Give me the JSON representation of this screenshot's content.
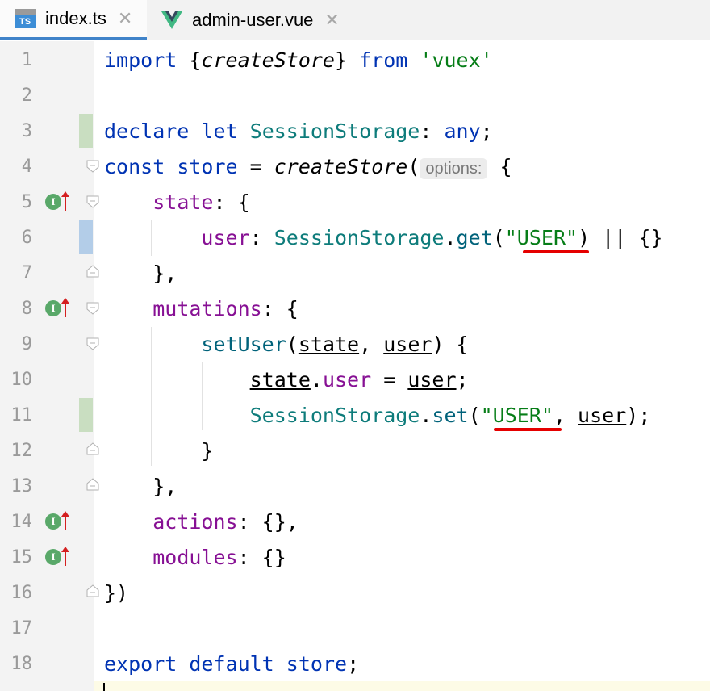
{
  "tabs": [
    {
      "icon": "typescript-file-icon",
      "icon_text": "TS",
      "label": "index.ts",
      "active": true
    },
    {
      "icon": "vue-file-icon",
      "label": "admin-user.vue",
      "active": false
    }
  ],
  "close_glyph": "✕",
  "gutter": {
    "implements_badge": "I",
    "line_numbers": [
      "1",
      "2",
      "3",
      "4",
      "5",
      "6",
      "7",
      "8",
      "9",
      "10",
      "11",
      "12",
      "13",
      "14",
      "15",
      "16",
      "17",
      "18"
    ]
  },
  "code": {
    "l1": {
      "kw1": "import",
      "p1": " {",
      "it1": "createStore",
      "p2": "} ",
      "kw2": "from",
      "p3": " ",
      "st1": "'vuex'"
    },
    "l3": {
      "kw1": "declare",
      "p1": " ",
      "kw2": "let",
      "p2": " ",
      "ty1": "SessionStorage",
      "p3": ": ",
      "kw3": "any",
      "p4": ";"
    },
    "l4": {
      "kw1": "const",
      "p1": " ",
      "kw2": "store",
      "p2": " = ",
      "it1": "createStore",
      "p3": "(",
      "hint": "options:",
      "p4": " {"
    },
    "l5": {
      "ind": "    ",
      "pr1": "state",
      "p1": ": {"
    },
    "l6": {
      "ind": "        ",
      "pr1": "user",
      "p1": ": ",
      "ty1": "SessionStorage",
      "p2": ".",
      "fn1": "get",
      "p3": "(",
      "st1": "\"USER\"",
      "p4": ") || {}"
    },
    "l7": {
      "ind": "    ",
      "p1": "},"
    },
    "l8": {
      "ind": "    ",
      "pr1": "mutations",
      "p1": ": {"
    },
    "l9": {
      "ind": "        ",
      "fn1": "setUser",
      "p1": "(",
      "u1": "state",
      "p2": ", ",
      "u2": "user",
      "p3": ") {"
    },
    "l10": {
      "ind": "            ",
      "u1": "state",
      "p1": ".",
      "pr1": "user",
      "p2": " = ",
      "u2": "user",
      "p3": ";"
    },
    "l11": {
      "ind": "            ",
      "ty1": "SessionStorage",
      "p1": ".",
      "fn1": "set",
      "p2": "(",
      "st1": "\"USER\"",
      "p3": ", ",
      "u1": "user",
      "p4": ");"
    },
    "l12": {
      "ind": "        ",
      "p1": "}"
    },
    "l13": {
      "ind": "    ",
      "p1": "},"
    },
    "l14": {
      "ind": "    ",
      "pr1": "actions",
      "p1": ": {},"
    },
    "l15": {
      "ind": "    ",
      "pr1": "modules",
      "p1": ": {}"
    },
    "l16": {
      "p1": "})"
    },
    "l18": {
      "kw1": "export",
      "p1": " ",
      "kw2": "default",
      "p2": " ",
      "kw3": "store",
      "p3": ";"
    }
  },
  "colors": {
    "keyword": "#0033b3",
    "type": "#0e7c7b",
    "property": "#871094",
    "function": "#00627a",
    "string": "#067d17",
    "gutter_added": "#c9dec1",
    "gutter_modified": "#b3cde8",
    "error_underline": "#e50000"
  }
}
